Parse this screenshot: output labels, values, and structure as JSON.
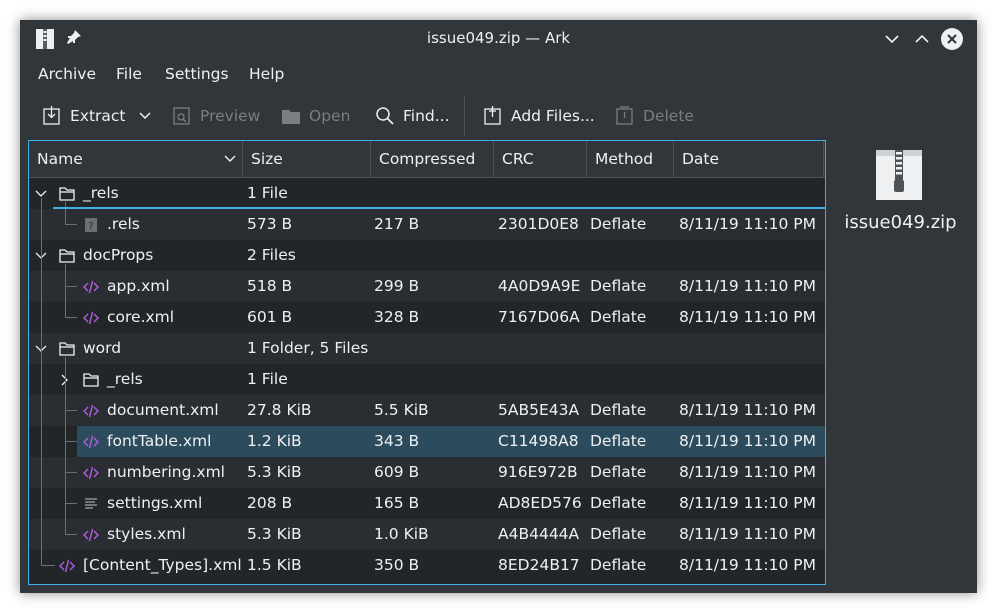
{
  "window": {
    "title": "issue049.zip — Ark"
  },
  "titlebar": {
    "app_icon": "archive-icon",
    "pin_icon": "pin-icon",
    "buttons": [
      "minimize-chevron-down-icon",
      "maximize-chevron-up-icon",
      "close-icon"
    ]
  },
  "menu": {
    "items": [
      "Archive",
      "File",
      "Settings",
      "Help"
    ]
  },
  "toolbar": {
    "extract": "Extract",
    "preview": "Preview",
    "open": "Open",
    "find": "Find...",
    "add_files": "Add Files...",
    "delete": "Delete"
  },
  "table": {
    "columns": [
      "Name",
      "Size",
      "Compressed",
      "CRC",
      "Method",
      "Date"
    ],
    "rows": [
      {
        "name": "_rels",
        "size": "1 File",
        "compressed": "",
        "crc": "",
        "method": "",
        "date": "",
        "type": "folder",
        "depth": 0,
        "expanded": true
      },
      {
        "name": ".rels",
        "size": "573 B",
        "compressed": "217 B",
        "crc": "2301D0E8",
        "method": "Deflate",
        "date": "8/11/19 11:10 PM",
        "type": "unknown-file",
        "depth": 1
      },
      {
        "name": "docProps",
        "size": "2 Files",
        "compressed": "",
        "crc": "",
        "method": "",
        "date": "",
        "type": "folder",
        "depth": 0,
        "expanded": true
      },
      {
        "name": "app.xml",
        "size": "518 B",
        "compressed": "299 B",
        "crc": "4A0D9A9E",
        "method": "Deflate",
        "date": "8/11/19 11:10 PM",
        "type": "xml-file",
        "depth": 1
      },
      {
        "name": "core.xml",
        "size": "601 B",
        "compressed": "328 B",
        "crc": "7167D06A",
        "method": "Deflate",
        "date": "8/11/19 11:10 PM",
        "type": "xml-file",
        "depth": 1
      },
      {
        "name": "word",
        "size": "1 Folder, 5 Files",
        "compressed": "",
        "crc": "",
        "method": "",
        "date": "",
        "type": "folder",
        "depth": 0,
        "expanded": true
      },
      {
        "name": "_rels",
        "size": "1 File",
        "compressed": "",
        "crc": "",
        "method": "",
        "date": "",
        "type": "folder",
        "depth": 1,
        "expanded": false
      },
      {
        "name": "document.xml",
        "size": "27.8 KiB",
        "compressed": "5.5 KiB",
        "crc": "5AB5E43A",
        "method": "Deflate",
        "date": "8/11/19 11:10 PM",
        "type": "xml-file",
        "depth": 1
      },
      {
        "name": "fontTable.xml",
        "size": "1.2 KiB",
        "compressed": "343 B",
        "crc": "C11498A8",
        "method": "Deflate",
        "date": "8/11/19 11:10 PM",
        "type": "xml-file",
        "depth": 1,
        "selected": true
      },
      {
        "name": "numbering.xml",
        "size": "5.3 KiB",
        "compressed": "609 B",
        "crc": "916E972B",
        "method": "Deflate",
        "date": "8/11/19 11:10 PM",
        "type": "xml-file",
        "depth": 1
      },
      {
        "name": "settings.xml",
        "size": "208 B",
        "compressed": "165 B",
        "crc": "AD8ED576",
        "method": "Deflate",
        "date": "8/11/19 11:10 PM",
        "type": "text-file",
        "depth": 1
      },
      {
        "name": "styles.xml",
        "size": "5.3 KiB",
        "compressed": "1.0 KiB",
        "crc": "A4B4444A",
        "method": "Deflate",
        "date": "8/11/19 11:10 PM",
        "type": "xml-file",
        "depth": 1
      },
      {
        "name": "[Content_Types].xml",
        "size": "1.5 KiB",
        "compressed": "350 B",
        "crc": "8ED24B17",
        "method": "Deflate",
        "date": "8/11/19 11:10 PM",
        "type": "xml-file",
        "depth": 0
      }
    ]
  },
  "info_panel": {
    "icon": "zip-archive-icon",
    "file_name": "issue049.zip"
  },
  "colors": {
    "window_bg": "#31363b",
    "view_bg": "#232629",
    "accent": "#3daee9",
    "selection": "#2c4c5d",
    "xml_icon": "#b05ede"
  }
}
